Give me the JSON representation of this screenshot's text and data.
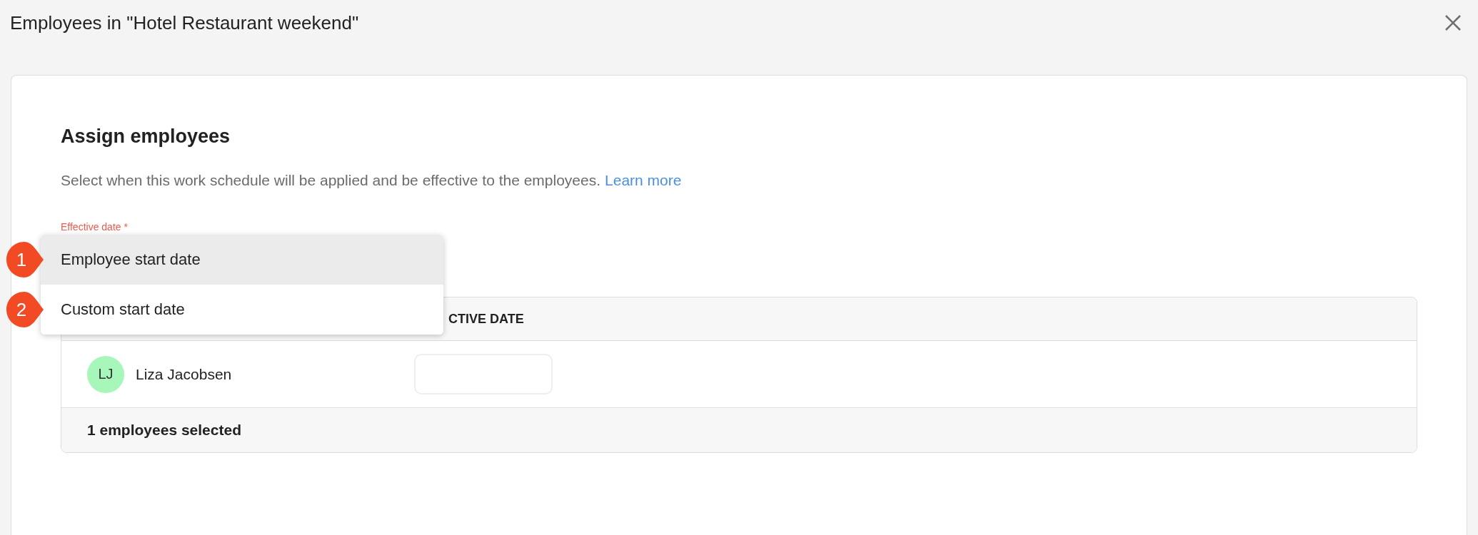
{
  "window": {
    "title": "Employees in \"Hotel Restaurant weekend\""
  },
  "section": {
    "title": "Assign employees",
    "description": "Select when this work schedule will be applied and be effective to the employees.",
    "link": "Learn more"
  },
  "field": {
    "label": "Effective date *"
  },
  "dropdown": {
    "options": [
      {
        "label": "Employee start date",
        "marker": "1",
        "selected": true
      },
      {
        "label": "Custom start date",
        "marker": "2",
        "selected": false
      }
    ]
  },
  "table": {
    "columns": [
      "CTIVE DATE"
    ],
    "rows": [
      {
        "initials": "LJ",
        "name": "Liza Jacobsen"
      }
    ],
    "footer": "1 employees selected"
  }
}
